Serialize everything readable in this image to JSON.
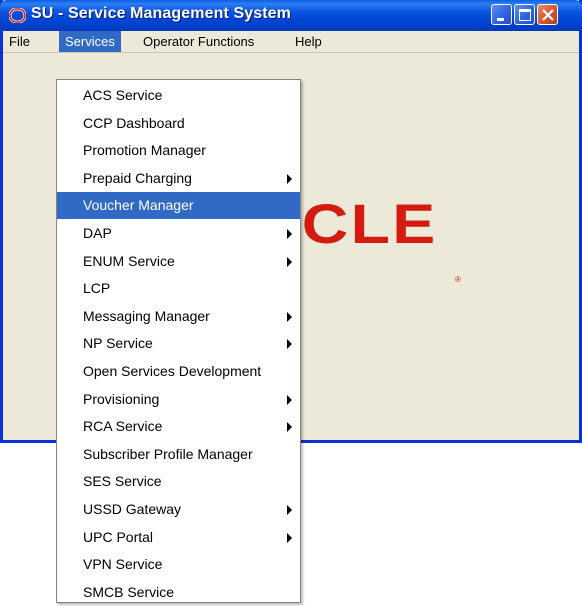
{
  "window": {
    "title": "SU - Service Management System",
    "logo_text": "ACLE",
    "logo_mark": "®",
    "colors": {
      "titlebar": "#0054e3",
      "menu_highlight": "#316ac5",
      "logo": "#d31b0f"
    }
  },
  "menubar": {
    "file": "File",
    "services": "Services",
    "operator": "Operator Functions",
    "help": "Help"
  },
  "services_menu": {
    "items": [
      {
        "label": "ACS Service",
        "submenu": false
      },
      {
        "label": "CCP Dashboard",
        "submenu": false
      },
      {
        "label": "Promotion Manager",
        "submenu": false
      },
      {
        "label": "Prepaid Charging",
        "submenu": true
      },
      {
        "label": "Voucher Manager",
        "submenu": false,
        "highlighted": true
      },
      {
        "label": "DAP",
        "submenu": true
      },
      {
        "label": "ENUM Service",
        "submenu": true
      },
      {
        "label": "LCP",
        "submenu": false
      },
      {
        "label": "Messaging Manager",
        "submenu": true
      },
      {
        "label": "NP Service",
        "submenu": true
      },
      {
        "label": "Open Services Development",
        "submenu": false
      },
      {
        "label": "Provisioning",
        "submenu": true
      },
      {
        "label": "RCA Service",
        "submenu": true
      },
      {
        "label": "Subscriber Profile Manager",
        "submenu": false
      },
      {
        "label": "SES Service",
        "submenu": false
      },
      {
        "label": "USSD Gateway",
        "submenu": true
      },
      {
        "label": "UPC Portal",
        "submenu": true
      },
      {
        "label": "VPN Service",
        "submenu": false
      },
      {
        "label": "SMCB Service",
        "submenu": false
      }
    ]
  },
  "icons": {
    "app": "oracle-o-icon",
    "minimize": "minimize-icon",
    "maximize": "maximize-icon",
    "close": "close-icon",
    "submenu": "submenu-arrow-icon"
  }
}
